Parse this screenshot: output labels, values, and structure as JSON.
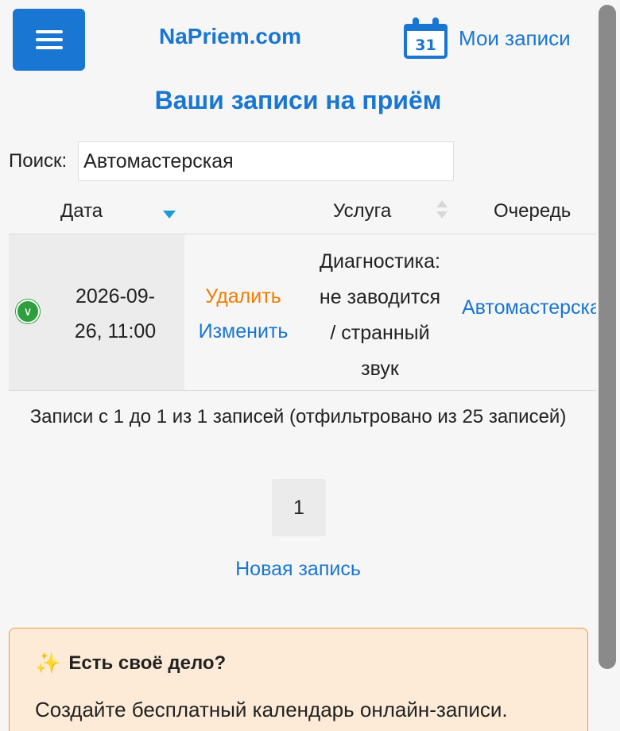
{
  "header": {
    "brand": "NaPriem.com",
    "calendar_day": "31",
    "my_appointments": "Мои записи"
  },
  "page_title": "Ваши записи на приём",
  "search": {
    "label": "Поиск:",
    "value": "Автомастерская"
  },
  "table": {
    "columns": [
      "Дата",
      "Услуга",
      "Очередь"
    ],
    "rows": [
      {
        "date_line1": "2026-09-",
        "date_line2": "26, 11:00",
        "delete": "Удалить",
        "edit": "Изменить",
        "service_lines": [
          "Диагностика:",
          "не заводится",
          "/ странный",
          "звук"
        ],
        "queue": "Автомастерская"
      }
    ]
  },
  "info": "Записи с 1 до 1 из 1 записей (отфильтровано из 25 записей)",
  "pager": {
    "current": "1"
  },
  "new_appointment": "Новая запись",
  "promo": {
    "title": "Есть своё дело?",
    "text": "Создайте бесплатный календарь онлайн-записи. Клиенты смогут записываться к вам"
  },
  "colors": {
    "accent": "#1976d2",
    "delete": "#ef7d00",
    "status_ok": "#2e9e3e",
    "promo_bg": "#fdebd8",
    "promo_border": "#e59a45"
  }
}
